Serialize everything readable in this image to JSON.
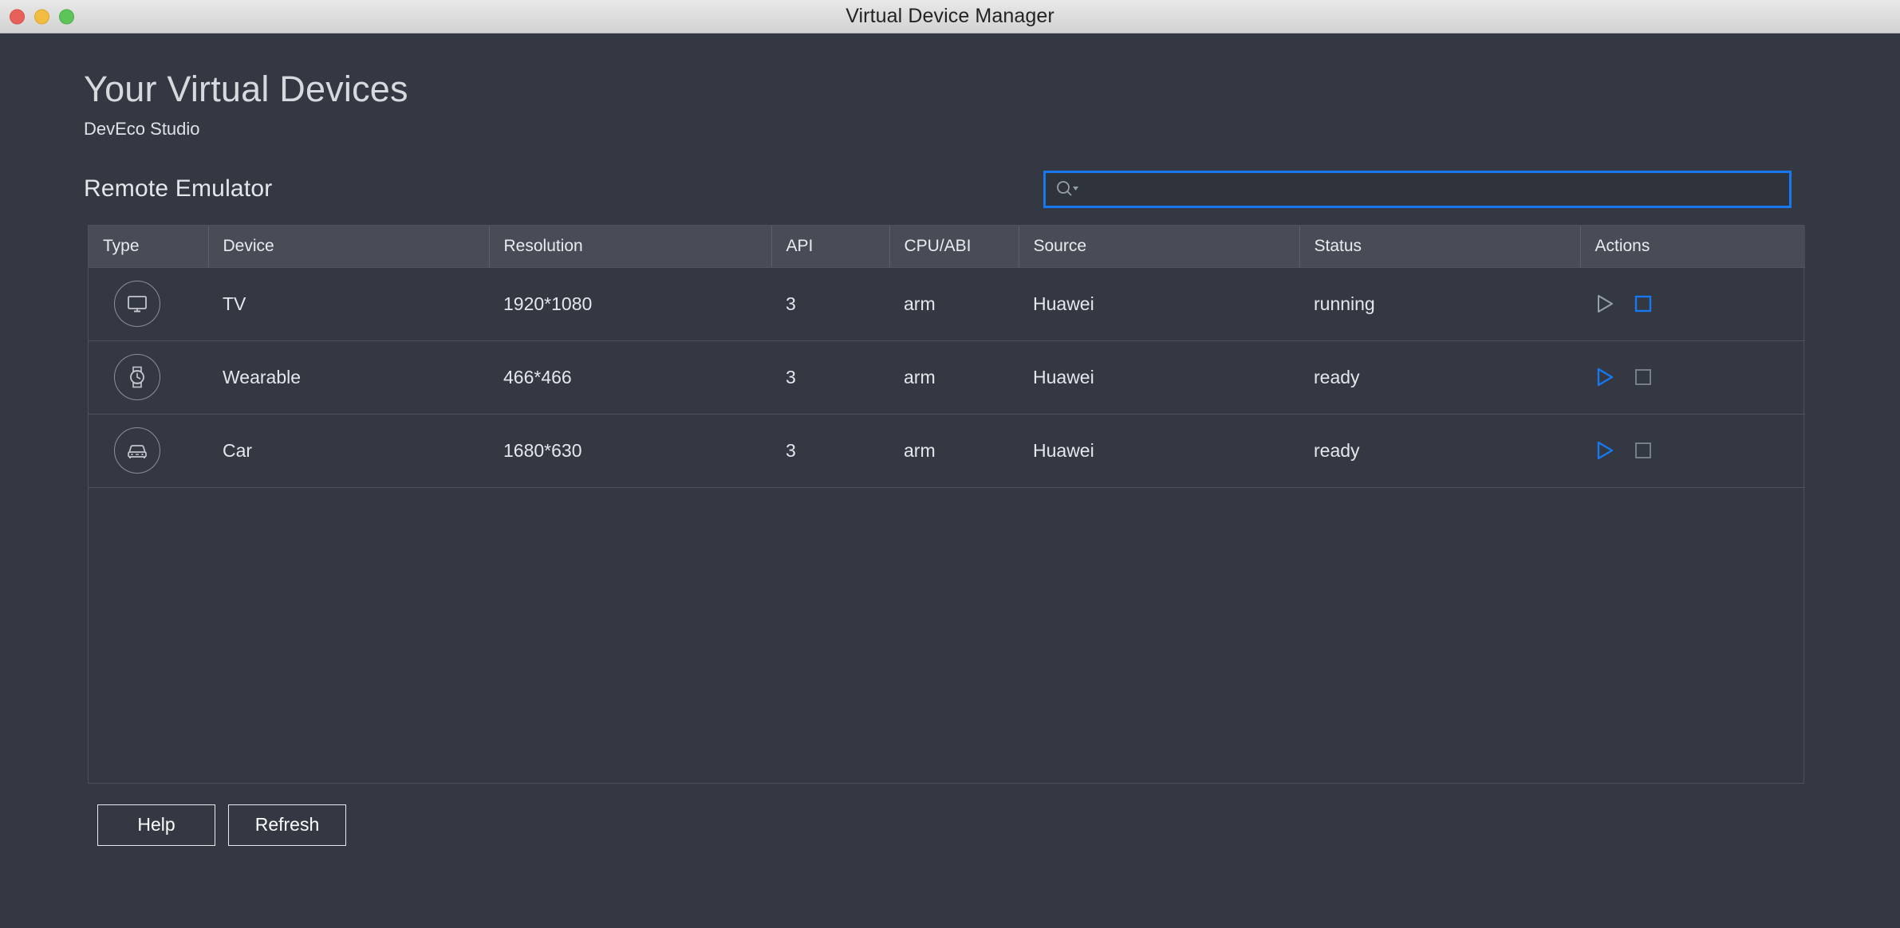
{
  "window": {
    "title": "Virtual Device Manager",
    "controls": {
      "close": "close-button",
      "minimize": "minimize-button",
      "maximize": "maximize-button"
    }
  },
  "header": {
    "title": "Your Virtual Devices",
    "subtitle": "DevEco Studio"
  },
  "section": {
    "title": "Remote Emulator"
  },
  "search": {
    "value": "",
    "placeholder": "",
    "icon": "search-icon"
  },
  "table": {
    "columns": [
      "Type",
      "Device",
      "Resolution",
      "API",
      "CPU/ABI",
      "Source",
      "Status",
      "Actions"
    ],
    "rows": [
      {
        "type_icon": "tv-icon",
        "device": "TV",
        "resolution": "1920*1080",
        "api": "3",
        "cpu_abi": "arm",
        "source": "Huawei",
        "status": "running",
        "play_enabled": false,
        "stop_enabled": true
      },
      {
        "type_icon": "watch-icon",
        "device": "Wearable",
        "resolution": "466*466",
        "api": "3",
        "cpu_abi": "arm",
        "source": "Huawei",
        "status": "ready",
        "play_enabled": true,
        "stop_enabled": false
      },
      {
        "type_icon": "car-icon",
        "device": "Car",
        "resolution": "1680*630",
        "api": "3",
        "cpu_abi": "arm",
        "source": "Huawei",
        "status": "ready",
        "play_enabled": true,
        "stop_enabled": false
      }
    ]
  },
  "footer": {
    "help_label": "Help",
    "refresh_label": "Refresh"
  },
  "colors": {
    "background": "#333842",
    "header_row": "#474c56",
    "accent_blue": "#1878f0",
    "text_primary": "#e4e7eb",
    "border": "#4c515b",
    "disabled_gray": "#8b9099"
  }
}
